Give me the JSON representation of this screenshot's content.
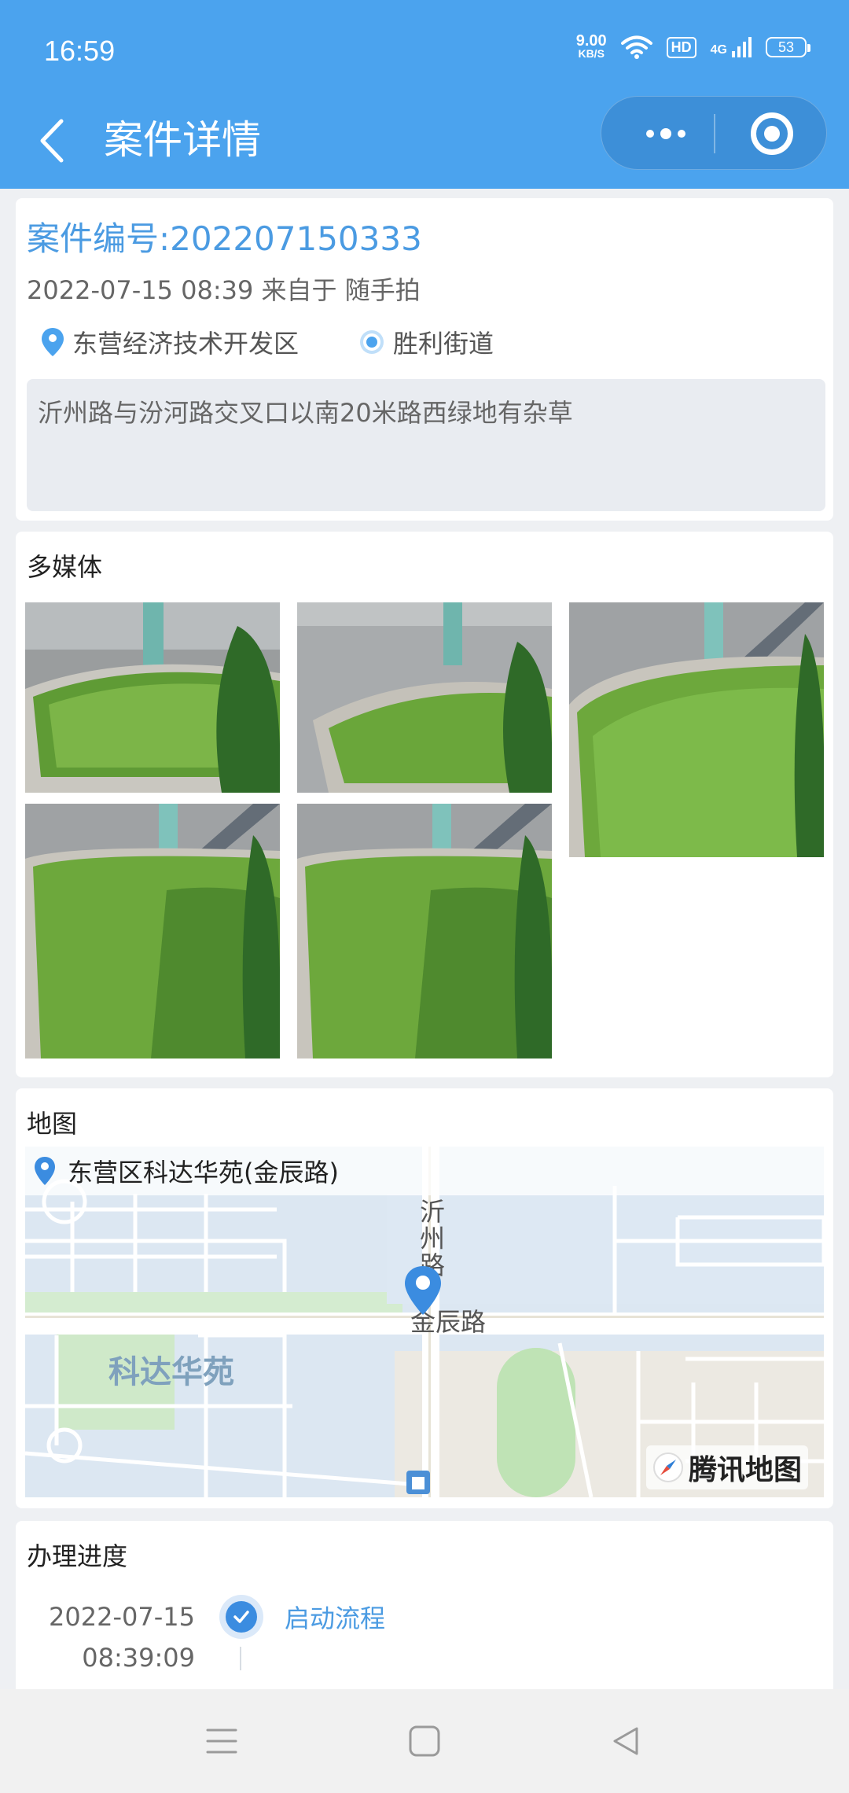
{
  "status_bar": {
    "time": "16:59",
    "speed_value": "9.00",
    "speed_unit": "KB/S",
    "hd_label": "HD",
    "network_label": "4G",
    "battery": "53"
  },
  "nav": {
    "title": "案件详情",
    "back_icon": "chevron-left-icon",
    "more_icon": "more-dots-icon",
    "close_icon": "target-icon"
  },
  "case": {
    "number": "案件编号:202207150333",
    "meta": "2022-07-15 08:39 来自于 随手拍",
    "district": "东营经济技术开发区",
    "street": "胜利街道",
    "description": "沂州路与汾河路交叉口以南20米路西绿地有杂草"
  },
  "media": {
    "title": "多媒体",
    "photos": [
      {
        "name": "photo-1"
      },
      {
        "name": "photo-2"
      },
      {
        "name": "photo-3"
      },
      {
        "name": "photo-4"
      },
      {
        "name": "photo-5"
      }
    ]
  },
  "map": {
    "title": "地图",
    "address": "东营区科达华苑(金辰路)",
    "label_community": "科达华苑",
    "label_road_vertical": "沂州路",
    "label_road_horizontal": "金辰路",
    "provider": "腾讯地图"
  },
  "progress": {
    "title": "办理进度",
    "steps": [
      {
        "date": "2022-07-15",
        "time": "08:39:09",
        "label": "启动流程"
      }
    ]
  },
  "colors": {
    "primary": "#4ba3ee",
    "link": "#4b9be2"
  }
}
